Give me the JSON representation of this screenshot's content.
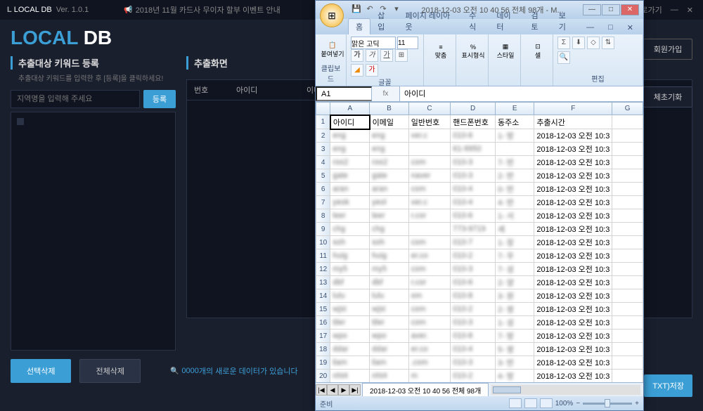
{
  "app": {
    "title_prefix": "L",
    "title": "LOCAL DB",
    "version": "Ver. 1.0.1",
    "notice": "2018년 11월 카드사 무이자 할부 이벤트 안내",
    "shortcut": "로가기",
    "logo_local": "LOCAL",
    "logo_db": " DB"
  },
  "left_panel": {
    "title": "추출대상 키워드 등록",
    "subtitle": "추출대상 키워드를 입력한 후 [등록]을 클릭하세요!",
    "input_placeholder": "지역명을 입력해 주세요",
    "register_btn": "등록"
  },
  "right_panel": {
    "title": "추출화면",
    "columns": {
      "num": "번호",
      "id": "아이디",
      "email": "이메일"
    }
  },
  "right_buttons": {
    "signup": "회원가입",
    "reset": "체초기화",
    "export": "TXT)저장"
  },
  "bottom": {
    "select_delete": "선택삭제",
    "all_delete": "전체삭제",
    "status_count": "0000",
    "status_msg": " 개의 새로운 데이터가 있습니다"
  },
  "excel": {
    "title": "2018-12-03 오전 10 40 56 전체   98개 - M...",
    "tabs": [
      "홈",
      "삽입",
      "페이지 레이아웃",
      "수식",
      "데이터",
      "검토",
      "보기"
    ],
    "ribbon_groups": {
      "clipboard": "클립보드",
      "font": "글꼴",
      "alignment": "맞춤",
      "number": "표시",
      "styles": "스타일",
      "cells": "셀",
      "editing": "편집"
    },
    "paste_label": "붙여넣기",
    "align_label": "맞춤",
    "format_label": "표시형식",
    "style_label": "스타일",
    "cell_label": "셀",
    "font_name": "맑은 고딕",
    "font_size": "11",
    "name_box": "A1",
    "formula_value": "아이디",
    "fx_label": "fx",
    "col_headers": [
      "A",
      "B",
      "C",
      "D",
      "E",
      "F",
      "G"
    ],
    "header_row": [
      "아이디",
      "이메일",
      "일반번호",
      "핸드폰번호",
      "동주소",
      "추출시간",
      ""
    ],
    "rows": [
      [
        "eng",
        "eng",
        "ver.c",
        "010-6",
        "1- 방",
        "2018-12-03 오전 10:3",
        ""
      ],
      [
        "eng",
        "eng",
        "",
        "61-9950",
        "",
        "2018-12-03 오전 10:3",
        ""
      ],
      [
        "roo2",
        "roo2",
        "com",
        "010-3",
        "7- 반",
        "2018-12-03 오전 10:3",
        ""
      ],
      [
        "gate",
        "gate",
        "naver",
        "010-3",
        "2- 반",
        "2018-12-03 오전 10:3",
        ""
      ],
      [
        "aran",
        "aran",
        "com",
        "010-4",
        "0- 반",
        "2018-12-03 오전 10:3",
        ""
      ],
      [
        "yeok",
        "yeol",
        "ver.c",
        "010-4",
        "4- 반",
        "2018-12-03 오전 10:3",
        ""
      ],
      [
        "leer",
        "leer",
        "r.cor",
        "010-6",
        "1- 서",
        "2018-12-03 오전 10:3",
        ""
      ],
      [
        "chg",
        "chg",
        "",
        "773-9719",
        "세",
        "2018-12-03 오전 10:3",
        ""
      ],
      [
        "soh",
        "soh",
        "com",
        "010-7",
        "1- 장",
        "2018-12-03 오전 10:3",
        ""
      ],
      [
        "huig",
        "huig",
        "er.co",
        "010-2",
        "7- 우",
        "2018-12-03 오전 10:3",
        ""
      ],
      [
        "my5",
        "my5",
        "com",
        "010-3",
        "7- 성",
        "2018-12-03 오전 10:3",
        ""
      ],
      [
        "dbf",
        "dbf",
        "r.cor",
        "010-6",
        "2- 양",
        "2018-12-03 오전 10:3",
        ""
      ],
      [
        "lulu",
        "lulu",
        "om",
        "010-8",
        "3- 원",
        "2018-12-03 오전 10:3",
        ""
      ],
      [
        "wjst",
        "wjst",
        "com",
        "010-2",
        "2- 쌍",
        "2018-12-03 오전 10:3",
        ""
      ],
      [
        "tiler",
        "tiler",
        "com",
        "010-3",
        "1- 성",
        "2018-12-03 오전 10:3",
        ""
      ],
      [
        "wpo",
        "wpo",
        "aver.",
        "010-8",
        "7- 방",
        "2018-12-03 오전 10:3",
        ""
      ],
      [
        "ddar",
        "ddar",
        "er.co",
        "010-4",
        "5- 쌍",
        "2018-12-03 오전 10:3",
        ""
      ],
      [
        "liam",
        "liam",
        ".com",
        "010-3",
        "3- 반",
        "2018-12-03 오전 10:3",
        ""
      ],
      [
        "nht4",
        "nht4",
        "m",
        "010-2",
        "4- 방",
        "2018-12-03 오전 10:3",
        ""
      ]
    ],
    "sheet_tab": "2018-12-03 오전 10 40 56 전체   98개",
    "status_ready": "준비",
    "zoom": "100%"
  }
}
